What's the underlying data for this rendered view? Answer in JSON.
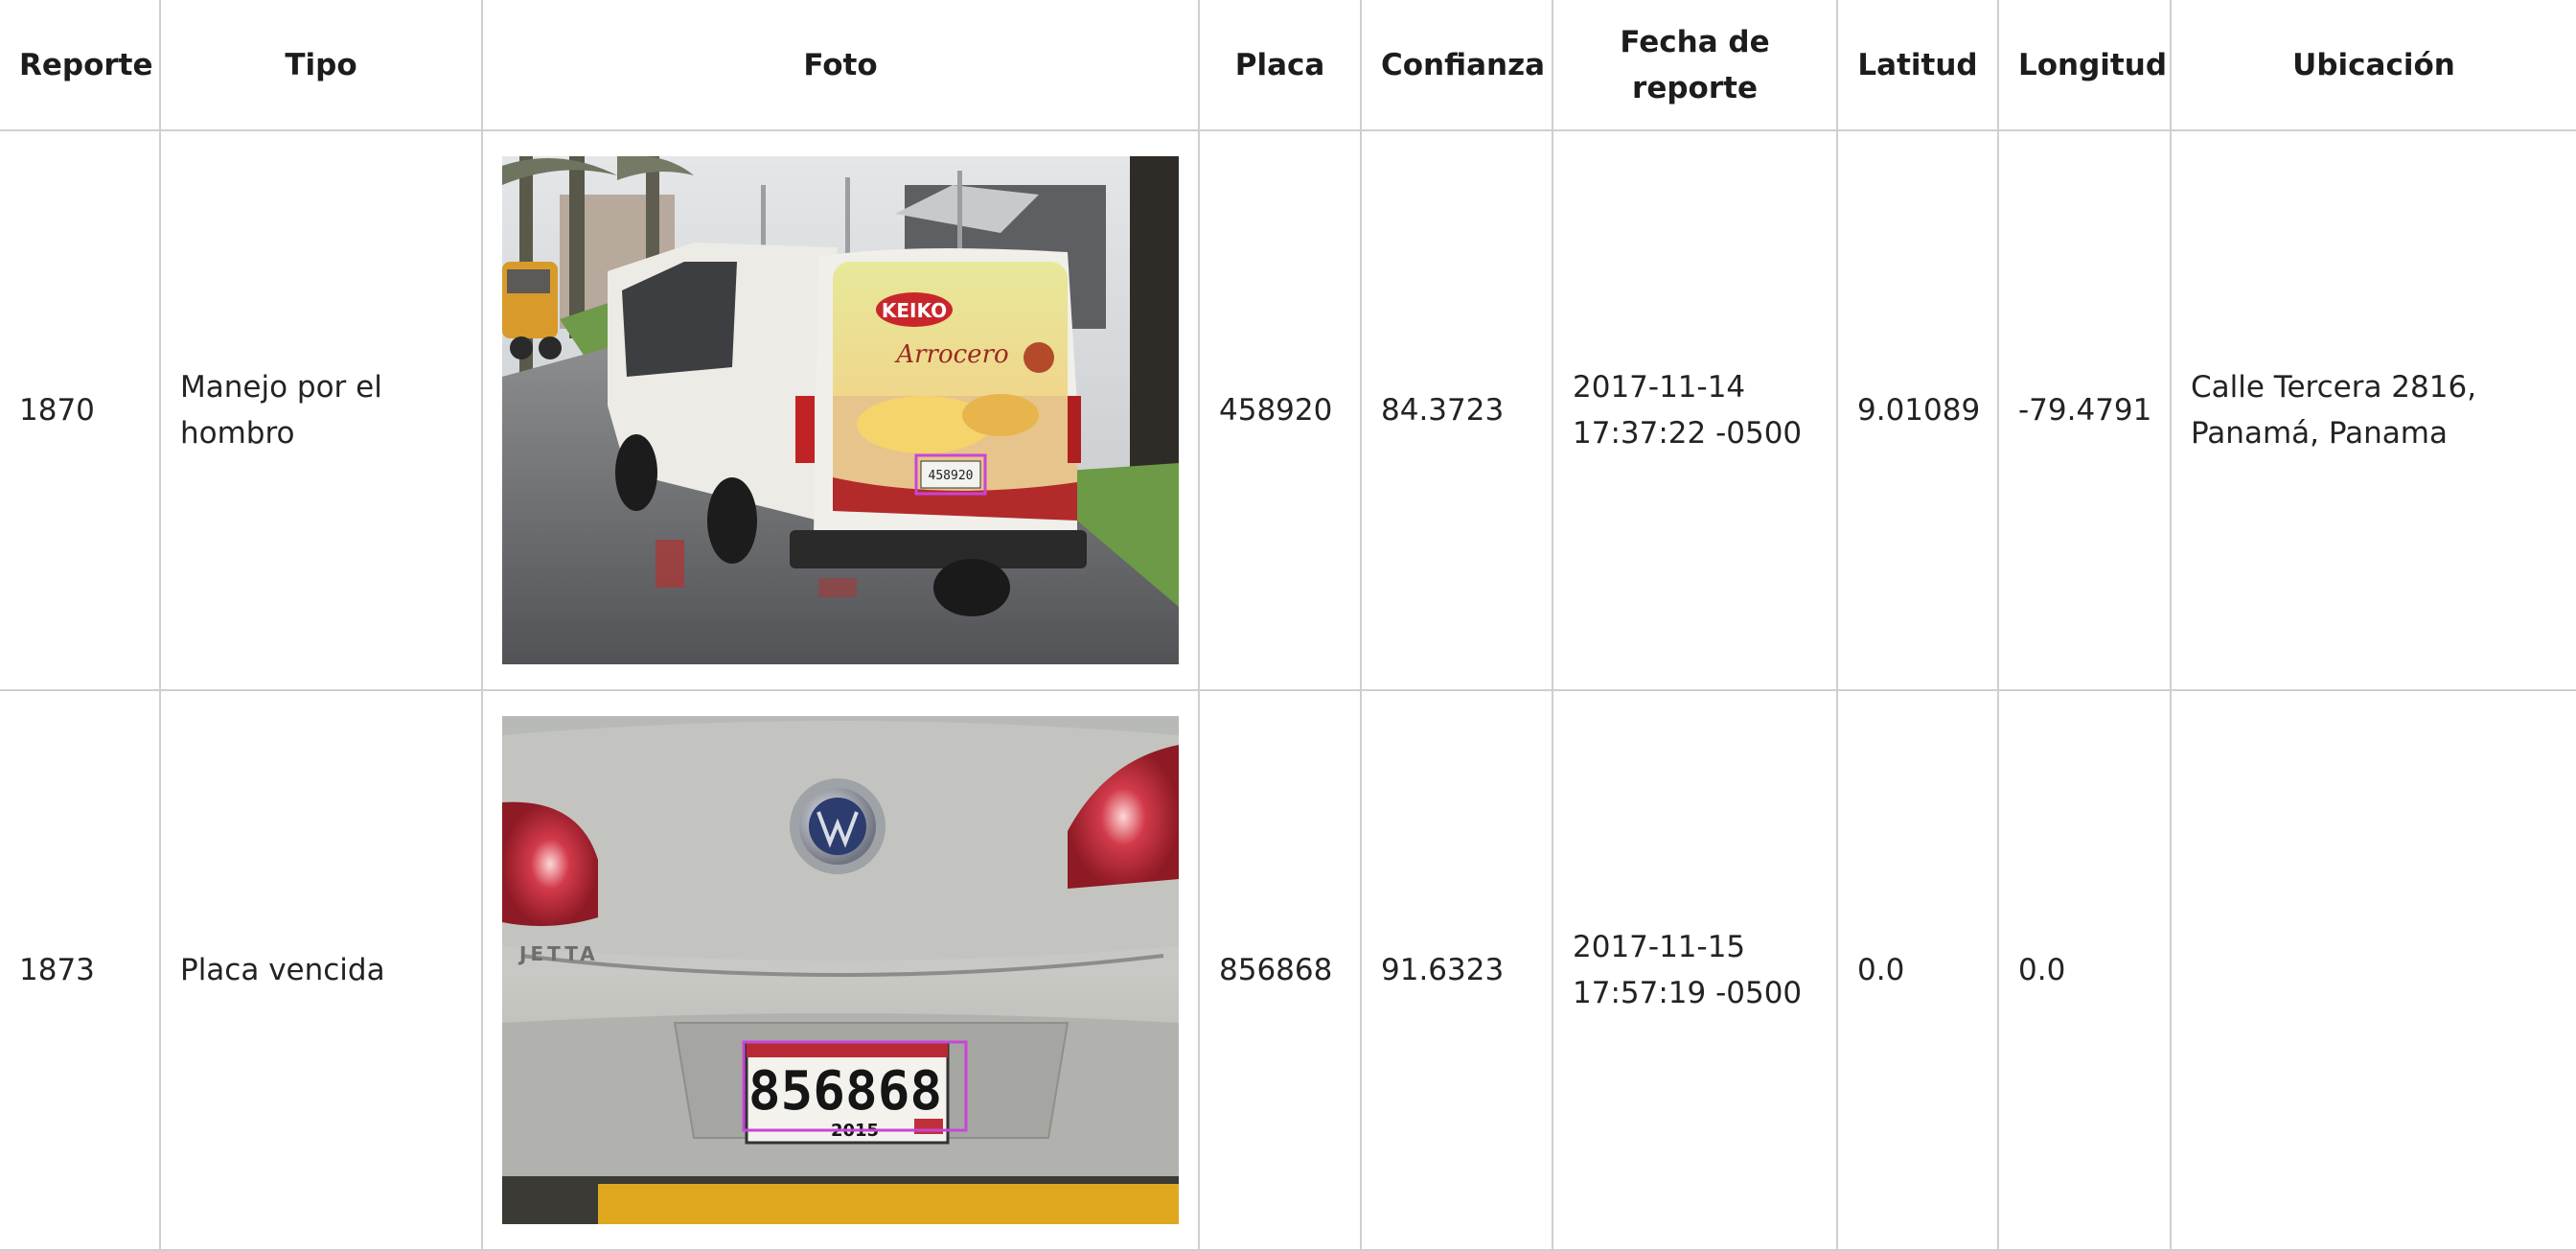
{
  "table": {
    "headers": [
      "Reporte",
      "Tipo",
      "Foto",
      "Placa",
      "Confianza",
      "Fecha de reporte",
      "Latitud",
      "Longitud",
      "Ubicación"
    ],
    "rows": [
      {
        "reporte": "1870",
        "tipo": "Manejo por el hombro",
        "foto": {
          "subject": "white van with yellow-red advertising rear, rainy street",
          "brand_text": "KEIKO",
          "product_text": "Arrocero",
          "plate_text": "458920"
        },
        "placa": "458920",
        "confianza": "84.3723",
        "fecha": "2017-11-14 17:37:22 -0500",
        "latitud": "9.01089",
        "longitud": "-79.4791",
        "ubicacion": "Calle Tercera 2816, Panamá, Panama"
      },
      {
        "reporte": "1873",
        "tipo": "Placa vencida",
        "foto": {
          "subject": "silver sedan trunk close-up",
          "model_text": "JETTA",
          "plate_text": "856868",
          "plate_year": "2015"
        },
        "placa": "856868",
        "confianza": "91.6323",
        "fecha": "2017-11-15 17:57:19 -0500",
        "latitud": "0.0",
        "longitud": "0.0",
        "ubicacion": ""
      }
    ]
  },
  "colors": {
    "border": "#cfcfcf",
    "detection_box": "#c845d8"
  }
}
